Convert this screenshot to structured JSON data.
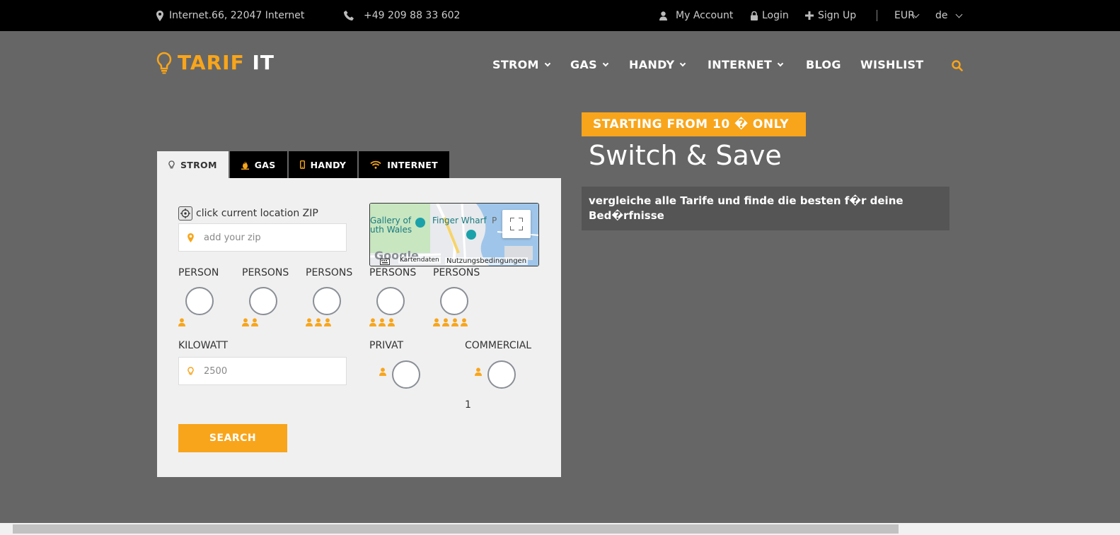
{
  "topbar": {
    "address": "Internet.66, 22047 Internet",
    "phone": "+49 209 88 33 602",
    "my_account": "My Account",
    "login": "Login",
    "signup": "Sign Up",
    "currency": "EUR",
    "language": "de"
  },
  "logo": {
    "part1": "TARIF",
    "part2": "IT"
  },
  "nav": {
    "strom": "STROM",
    "gas": "GAS",
    "handy": "HANDY",
    "internet": "INTERNET",
    "blog": "BLOG",
    "wishlist": "WISHLIST"
  },
  "tabs": {
    "strom": "STROM",
    "gas": "GAS",
    "handy": "HANDY",
    "internet": "INTERNET"
  },
  "form": {
    "location_label": "click current location ZIP",
    "zip_placeholder": "add your zip",
    "person_labels": [
      "PERSON",
      "PERSONS",
      "PERSONS",
      "PERSONS",
      "PERSONS"
    ],
    "kilowatt_label": "KILOWATT",
    "kilowatt_value": "2500",
    "privat_label": "PRIVAT",
    "commercial_label": "COMMERCIAL",
    "count": "1",
    "search_button": "SEARCH"
  },
  "map": {
    "label_gallery": "Gallery of",
    "label_wales": "uth Wales",
    "label_wharf": "Finger Wharf",
    "label_p": "P",
    "google": "Google",
    "kartendaten": "Kartendaten",
    "terms": "Nutzungsbedingungen"
  },
  "hero": {
    "badge": "STARTING FROM 10 � ONLY",
    "title": "Switch & Save",
    "description": "vergleiche alle  Tarife und finde die besten f�r deine Bed�rfnisse"
  },
  "colors": {
    "accent": "#f8a51b",
    "background": "#666666",
    "topbar": "#000000"
  }
}
